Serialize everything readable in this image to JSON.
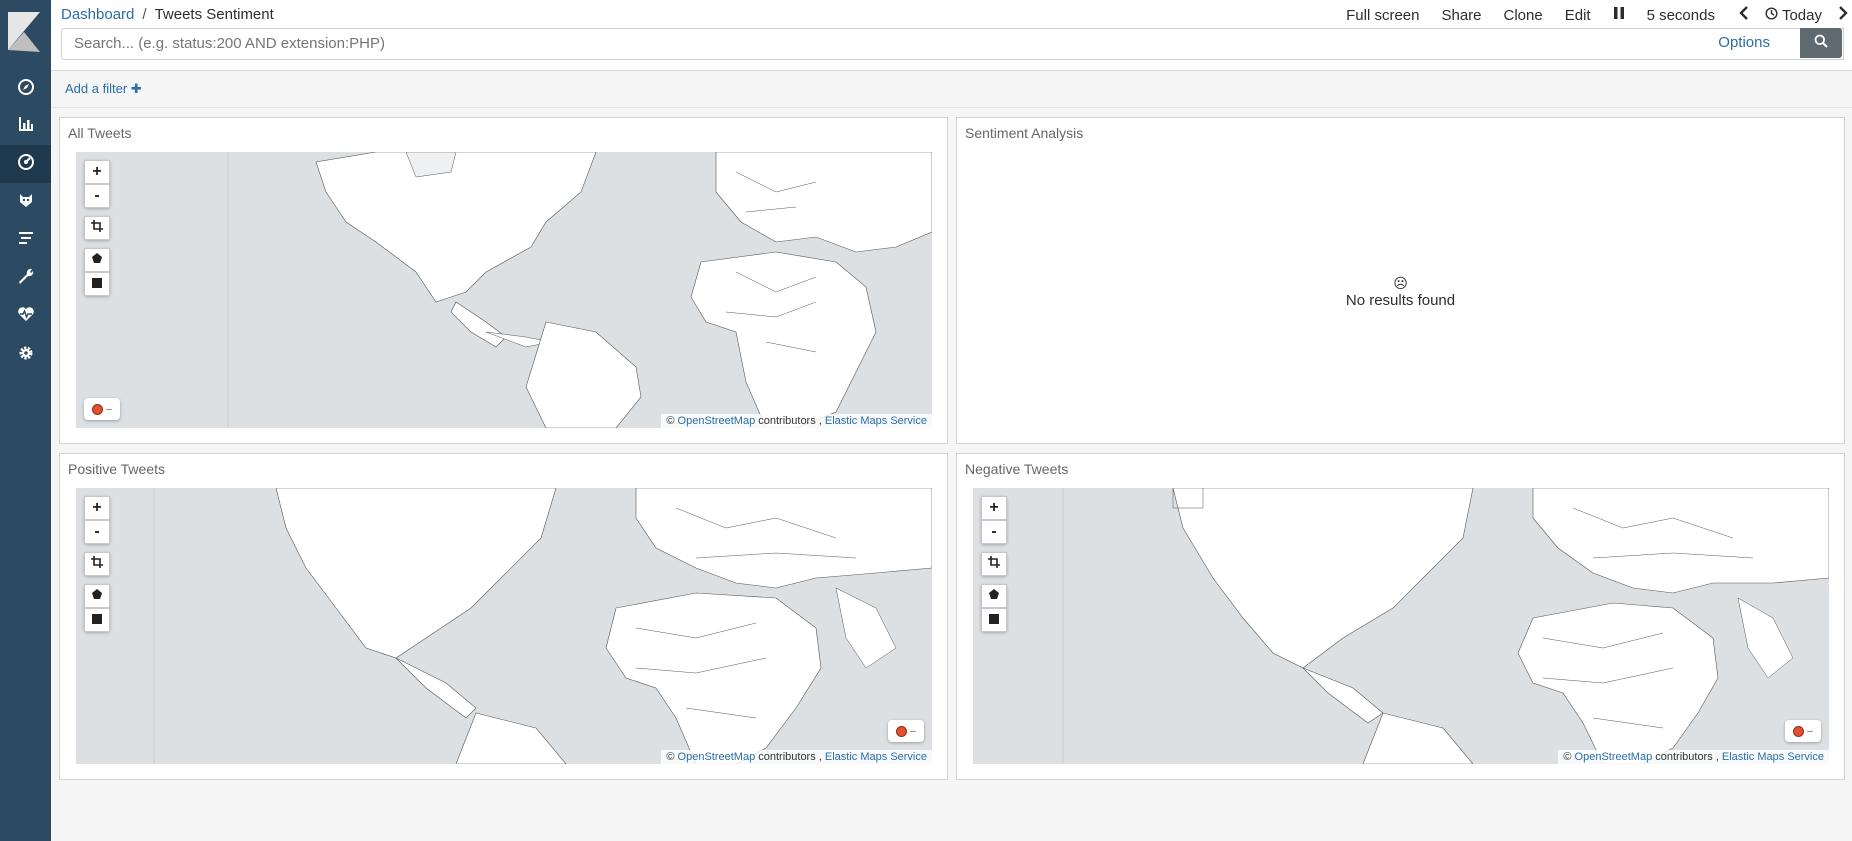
{
  "breadcrumb": {
    "root": "Dashboard",
    "separator": "/",
    "current": "Tweets Sentiment"
  },
  "top_menu": {
    "full_screen": "Full screen",
    "share": "Share",
    "clone": "Clone",
    "edit": "Edit",
    "refresh_interval": "5 seconds",
    "time_range": "Today"
  },
  "search": {
    "placeholder": "Search... (e.g. status:200 AND extension:PHP)",
    "options_label": "Options"
  },
  "filter": {
    "add_label": "Add a filter ✚"
  },
  "panels": {
    "all_tweets": {
      "title": "All Tweets",
      "legend": "–"
    },
    "sentiment": {
      "title": "Sentiment Analysis",
      "empty_text": "No results found",
      "empty_icon": "☹"
    },
    "positive": {
      "title": "Positive Tweets",
      "legend": "–"
    },
    "negative": {
      "title": "Negative Tweets",
      "legend": "–"
    }
  },
  "map_controls": {
    "zoom_in": "+",
    "zoom_out": "-"
  },
  "attribution": {
    "copyright": "©",
    "osm": "OpenStreetMap",
    "contributors": "contributors ,",
    "ems": "Elastic Maps Service"
  },
  "sidebar": {
    "items": [
      "compass-icon",
      "bar-chart-icon",
      "dashboard-icon",
      "timelion-icon",
      "apm-icon",
      "wrench-icon",
      "heartbeat-icon",
      "gear-icon"
    ],
    "active": "dashboard-icon"
  },
  "colors": {
    "sidebar": "#2c4a61",
    "accent": "#2a6ea6",
    "marker": "#e0522f"
  }
}
